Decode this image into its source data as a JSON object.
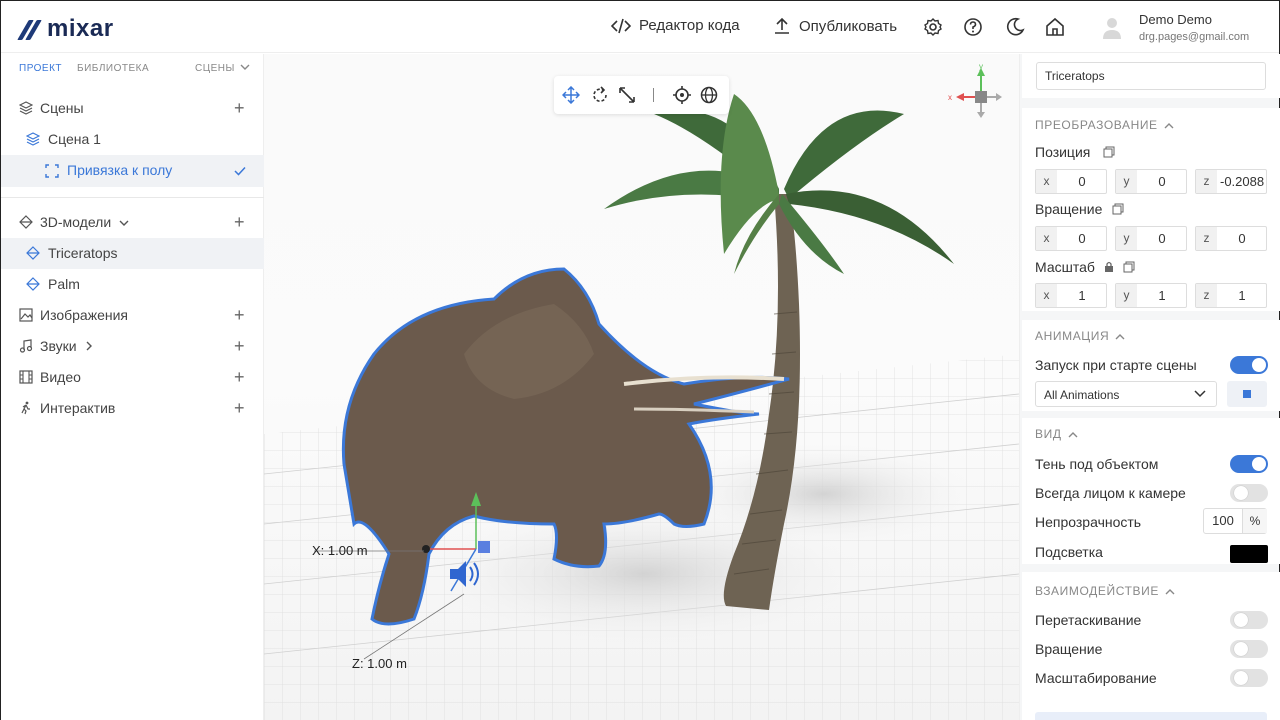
{
  "brand": {
    "name": "mixar"
  },
  "topbar": {
    "code_editor": "Редактор кода",
    "publish": "Опубликовать",
    "user_name": "Demo Demo",
    "user_email": "drg.pages@gmail.com"
  },
  "sidebar": {
    "tabs": {
      "project": "ПРОЕКТ",
      "library": "БИБЛИОТЕКА",
      "scenes": "СЦЕНЫ"
    },
    "scenes_label": "Сцены",
    "scene_1": "Сцена 1",
    "anchor": "Привязка к полу",
    "models_label": "3D-модели",
    "model_1": "Triceratops",
    "model_2": "Palm",
    "images": "Изображения",
    "sounds": "Звуки",
    "video": "Видео",
    "interactive": "Интерактив"
  },
  "viewport": {
    "x_label": "X: 1.00 m",
    "z_label": "Z: 1.00 m",
    "accent": "#3b78d8"
  },
  "panel": {
    "object_name": "Triceratops",
    "transform": {
      "title": "ПРЕОБРАЗОВАНИЕ",
      "position": "Позиция",
      "rotation": "Вращение",
      "scale": "Масштаб",
      "pos": {
        "x": "0",
        "y": "0",
        "z": "-0.2088"
      },
      "rot": {
        "x": "0",
        "y": "0",
        "z": "0"
      },
      "scl": {
        "x": "1",
        "y": "1",
        "z": "1"
      },
      "ax_x": "x",
      "ax_y": "y",
      "ax_z": "z"
    },
    "animation": {
      "title": "АНИМАЦИЯ",
      "autostart": "Запуск при старте сцены",
      "autostart_on": true,
      "select_value": "All Animations"
    },
    "view": {
      "title": "ВИД",
      "shadow": "Тень под объектом",
      "shadow_on": true,
      "face_camera": "Всегда лицом к камере",
      "face_camera_on": false,
      "opacity": "Непрозрачность",
      "opacity_value": "100",
      "opacity_unit": "%",
      "highlight": "Подсветка",
      "highlight_color": "#000000"
    },
    "interaction": {
      "title": "ВЗАИМОДЕЙСТВИЕ",
      "drag": "Перетаскивание",
      "drag_on": false,
      "rotate": "Вращение",
      "rotate_on": false,
      "scale": "Масштабирование",
      "scale_on": false
    }
  }
}
